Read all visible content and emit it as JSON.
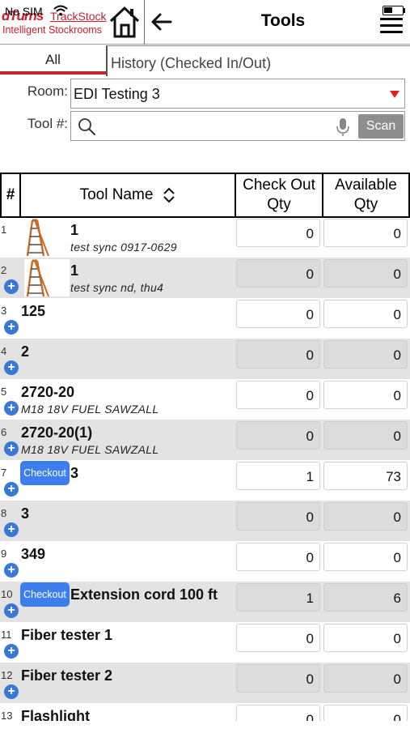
{
  "status": {
    "carrier": "No SIM"
  },
  "header": {
    "brand": "dTurns",
    "product": "TrackStock",
    "tagline": "Intelligent Stockrooms",
    "title": "Tools"
  },
  "tabs": [
    {
      "label": "All",
      "active": true
    },
    {
      "label": "History (Checked In/Out)",
      "active": false
    }
  ],
  "filters": {
    "room_label": "Room:",
    "room_value": "EDI Testing 3",
    "tool_label": "Tool #:",
    "tool_value": "",
    "scan_label": "Scan"
  },
  "table": {
    "columns": [
      "#",
      "Tool Name",
      "Check Out Qty",
      "Available Qty"
    ],
    "rows": [
      {
        "num": "1",
        "name": "1",
        "desc": "test sync 0917-0629",
        "checkout_qty": "0",
        "available_qty": "0",
        "thumb": "ladder"
      },
      {
        "num": "2",
        "name": "1",
        "desc": "test sync nd, thu4",
        "checkout_qty": "0",
        "available_qty": "0",
        "thumb": "ladder"
      },
      {
        "num": "3",
        "name": "125",
        "desc": "",
        "checkout_qty": "0",
        "available_qty": "0"
      },
      {
        "num": "4",
        "name": "2",
        "desc": "",
        "checkout_qty": "0",
        "available_qty": "0"
      },
      {
        "num": "5",
        "name": "2720-20",
        "desc": "M18 18V FUEL SAWZALL",
        "checkout_qty": "0",
        "available_qty": "0"
      },
      {
        "num": "6",
        "name": "2720-20(1)",
        "desc": "M18 18V FUEL SAWZALL",
        "checkout_qty": "0",
        "available_qty": "0"
      },
      {
        "num": "7",
        "name": "3",
        "desc": "",
        "checkout_qty": "1",
        "available_qty": "73",
        "badge": "Checkout"
      },
      {
        "num": "8",
        "name": "3",
        "desc": "",
        "checkout_qty": "0",
        "available_qty": "0"
      },
      {
        "num": "9",
        "name": "349",
        "desc": "",
        "checkout_qty": "0",
        "available_qty": "0"
      },
      {
        "num": "10",
        "name": "Extension cord 100 ft",
        "desc": "",
        "checkout_qty": "1",
        "available_qty": "6",
        "badge": "Checkout"
      },
      {
        "num": "11",
        "name": "Fiber tester 1",
        "desc": "",
        "checkout_qty": "0",
        "available_qty": "0"
      },
      {
        "num": "12",
        "name": "Fiber tester 2",
        "desc": "",
        "checkout_qty": "0",
        "available_qty": "0"
      },
      {
        "num": "13",
        "name": "Flashlight",
        "desc": "",
        "checkout_qty": "0",
        "available_qty": "0"
      }
    ]
  },
  "colors": {
    "accent": "#c8202f",
    "button_blue": "#3d7eef",
    "row_alt": "#e3e3e3"
  },
  "icons": [
    "home-icon",
    "back-arrow-icon",
    "hamburger-menu-icon",
    "search-icon",
    "microphone-icon",
    "sort-icon",
    "add-circle-icon",
    "ladder-icon"
  ]
}
